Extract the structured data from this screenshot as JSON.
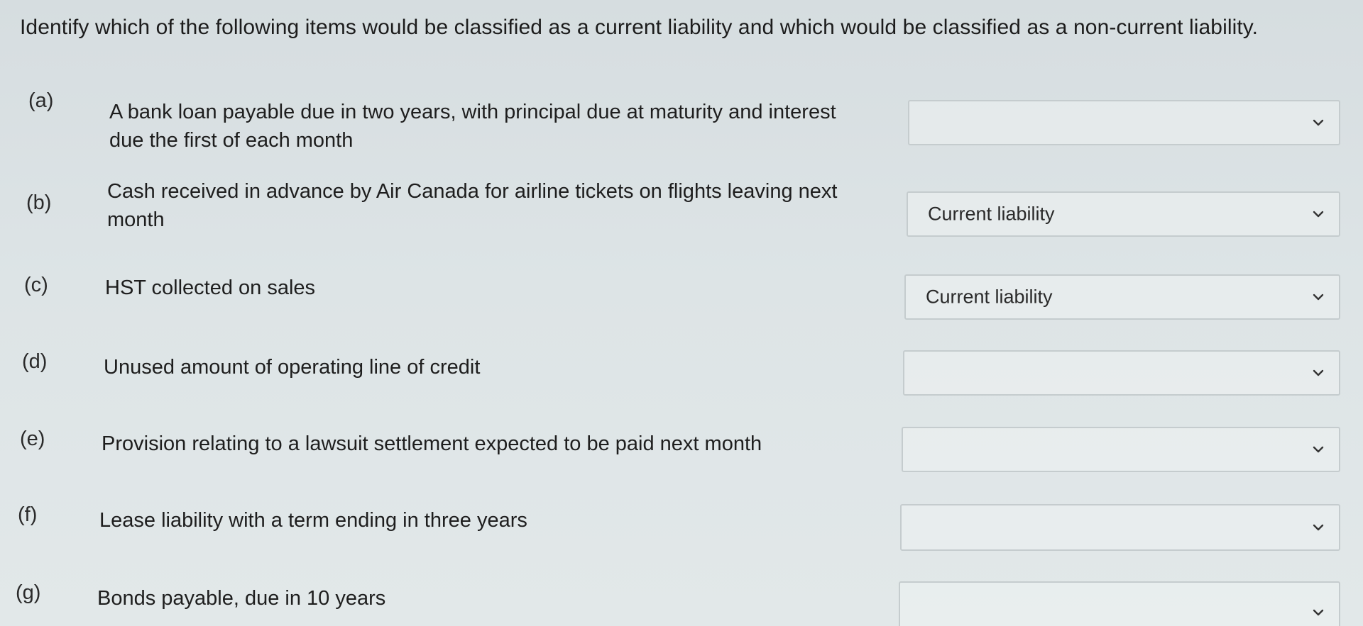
{
  "instructions": "Identify which of the following items would be classified as a current liability and which would be classified as a non-current liability.",
  "questions": [
    {
      "letter": "(a)",
      "text": "A bank loan payable due in two years, with principal due at maturity and interest due the first of each month",
      "selected": ""
    },
    {
      "letter": "(b)",
      "text": "Cash received in advance by Air Canada for airline tickets on flights leaving next month",
      "selected": "Current liability"
    },
    {
      "letter": "(c)",
      "text": "HST collected on sales",
      "selected": "Current liability"
    },
    {
      "letter": "(d)",
      "text": "Unused amount of operating line of credit",
      "selected": ""
    },
    {
      "letter": "(e)",
      "text": "Provision relating to a lawsuit settlement expected to be paid next month",
      "selected": ""
    },
    {
      "letter": "(f)",
      "text": "Lease liability with a term ending in three years",
      "selected": ""
    },
    {
      "letter": "(g)",
      "text": "Bonds payable, due in 10 years",
      "selected": ""
    }
  ],
  "icons": {
    "dropdown": "chevron-down-icon"
  }
}
